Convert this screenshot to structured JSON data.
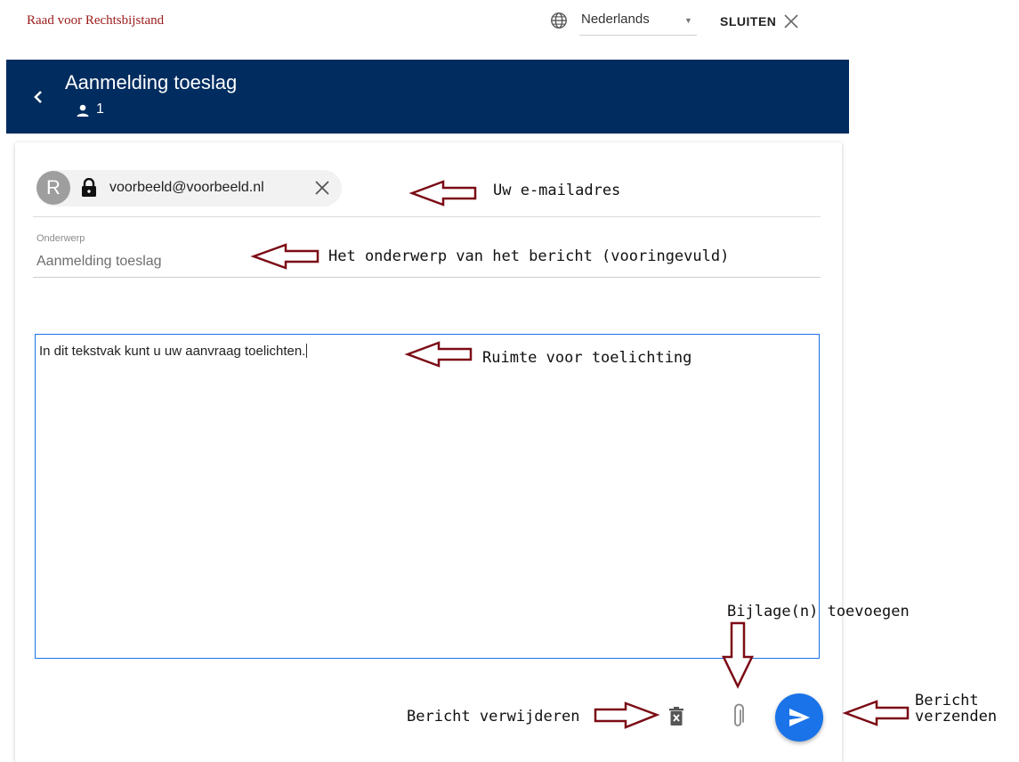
{
  "header": {
    "logo_text": "Raad voor Rechtsbijstand",
    "language": "Nederlands",
    "close_label": "SLUITEN",
    "icons": {
      "language": "globe-icon",
      "dropdown": "caret-down-icon",
      "close": "close-icon"
    }
  },
  "topbar": {
    "title": "Aanmelding toeslag",
    "participant_count": "1",
    "background": "#002c5f",
    "icons": {
      "back": "chevron-left-icon",
      "participants": "person-icon"
    }
  },
  "compose": {
    "recipient": {
      "avatar_initial": "R",
      "email": "voorbeeld@voorbeeld.nl",
      "icons": {
        "lock": "lock-icon",
        "remove": "close-icon"
      }
    },
    "subject_label": "Onderwerp",
    "subject_value": "Aanmelding toeslag",
    "body_text": "In dit tekstvak kunt u uw aanvraag toelichten.",
    "actions": {
      "icons": {
        "delete": "trash-icon",
        "attach": "paperclip-icon",
        "send": "send-icon"
      },
      "send_color": "#1a73e8"
    }
  },
  "annotations": {
    "email": "Uw e-mailadres",
    "subject": "Het onderwerp van het bericht (vooringevuld)",
    "body": "Ruimte voor toelichting",
    "attach": "Bijlage(n) toevoegen",
    "delete": "Bericht verwijderen",
    "send_line1": "Bericht",
    "send_line2": "verzenden",
    "arrow_color": "#7b0a14"
  }
}
